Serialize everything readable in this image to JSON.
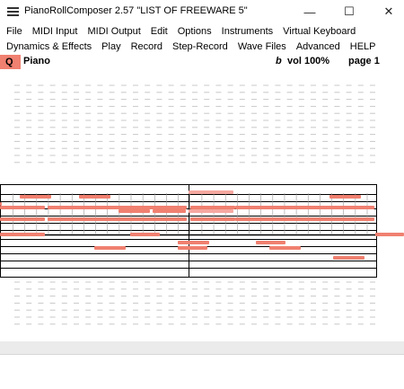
{
  "window": {
    "title": "PianoRollComposer 2.57  \"LIST OF FREEWARE 5\"",
    "minimize_glyph": "—",
    "maximize_glyph": "☐",
    "close_glyph": "✕"
  },
  "menu_row1": [
    "File",
    "MIDI Input",
    "MIDI Output",
    "Edit",
    "Options",
    "Instruments",
    "Virtual Keyboard"
  ],
  "menu_row2": [
    "Dynamics & Effects",
    "Play",
    "Record",
    "Step-Record",
    "Wave Files",
    "Advanced",
    "HELP"
  ],
  "track": {
    "q_label": "Q",
    "instrument": "Piano",
    "flat_symbol": "b",
    "volume": "vol 100%",
    "page": "page 1"
  },
  "colors": {
    "note": "#f08070",
    "note_light": "#f5a8a0",
    "staff_line": "#000000",
    "ledger_dash": "#c8c8c8",
    "footer": "#ebebeb"
  },
  "icons": {
    "app": "hamburger-icon",
    "minimize": "minimize-icon",
    "maximize": "maximize-icon",
    "close": "close-icon"
  }
}
